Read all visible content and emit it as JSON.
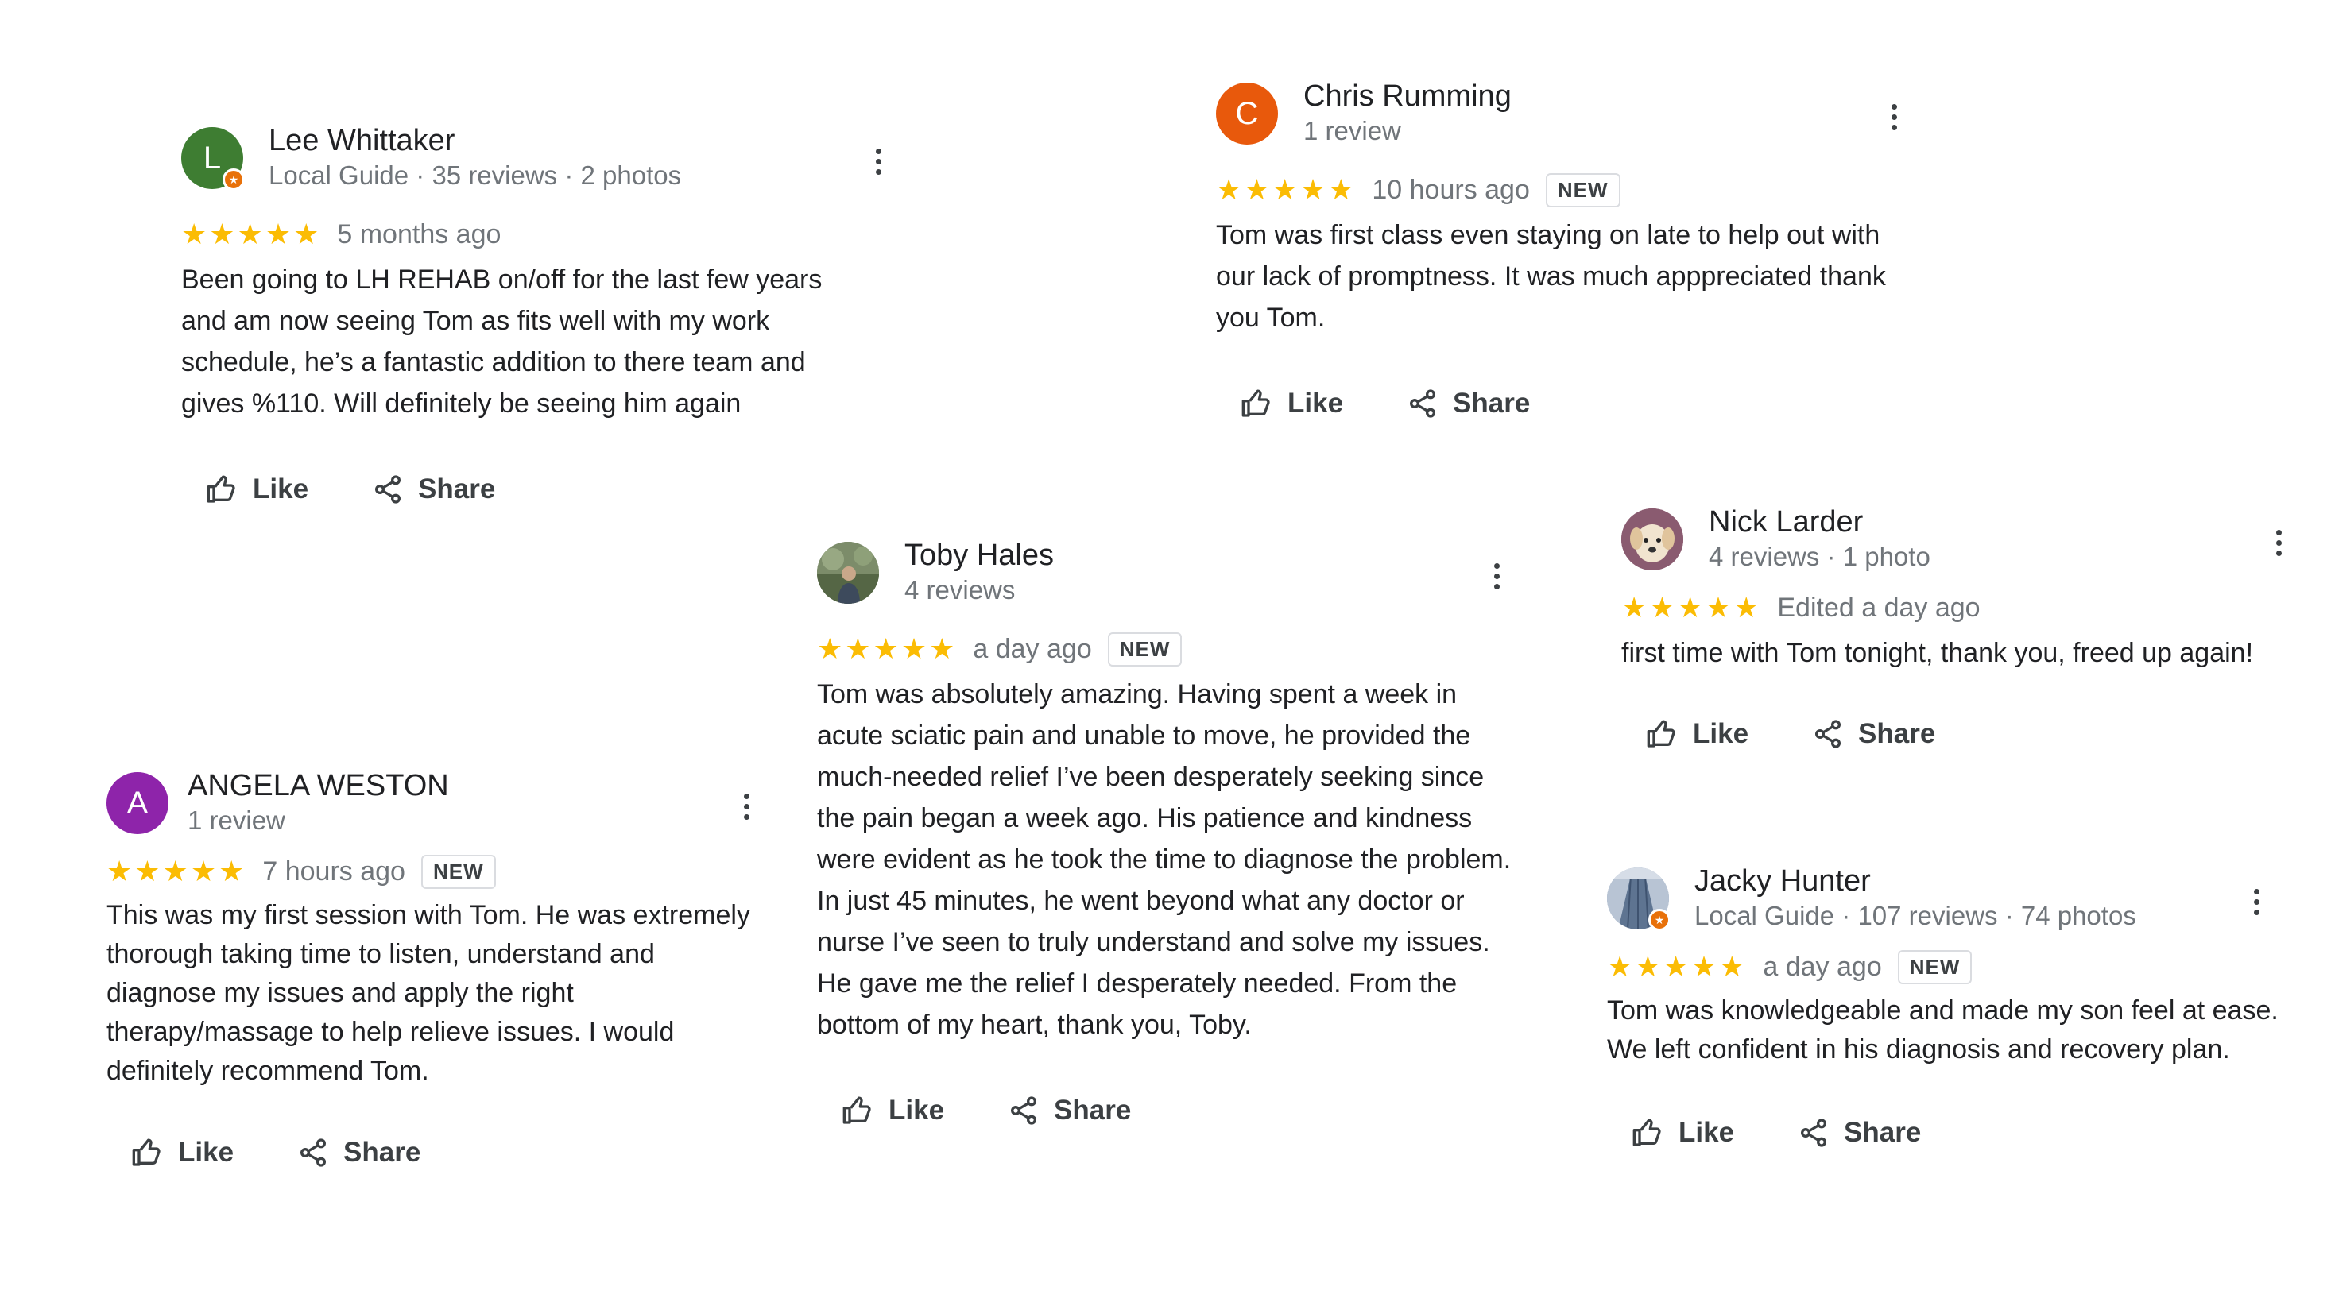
{
  "reviews": [
    {
      "id": "lee",
      "name": "Lee Whittaker",
      "meta": "Local Guide · 35 reviews · 2 photos",
      "avatar_letter": "L",
      "avatar_color": "#3e7d32",
      "local_guide": true,
      "stars": "★★★★★",
      "time": "5 months ago",
      "new_badge": "",
      "text": "Been going to LH REHAB on/off for the last few years and am now seeing Tom as fits well with my work schedule, he’s a fantastic addition to there team and gives %110. Will definitely be seeing him again",
      "like_label": "Like",
      "share_label": "Share"
    },
    {
      "id": "chris",
      "name": "Chris Rumming",
      "meta": "1 review",
      "avatar_letter": "C",
      "avatar_color": "#e8590c",
      "stars": "★★★★★",
      "time": "10 hours ago",
      "new_badge": "NEW",
      "text": "Tom was first class even staying on late to help out with our lack of promptness. It was much apppreciated thank you Tom.",
      "like_label": "Like",
      "share_label": "Share"
    },
    {
      "id": "toby",
      "name": "Toby Hales",
      "meta": "4 reviews",
      "avatar_icon": "outdoor-photo-avatar",
      "stars": "★★★★★",
      "time": "a day ago",
      "new_badge": "NEW",
      "text": "Tom was absolutely amazing.  Having spent a week in acute sciatic pain and unable to move, he provided the much-needed relief I’ve been desperately seeking since the pain began a week ago.  His patience and kindness were evident as he took the time to diagnose the problem.  In just 45 minutes, he went beyond what any doctor or nurse I’ve seen to truly understand and solve my issues.  He gave me the relief I desperately needed. From the bottom of my heart, thank you, Toby.",
      "like_label": "Like",
      "share_label": "Share"
    },
    {
      "id": "nick",
      "name": "Nick Larder",
      "meta": "4 reviews · 1 photo",
      "avatar_icon": "dog-photo-avatar",
      "stars": "★★★★★",
      "time": "Edited a day ago",
      "new_badge": "",
      "text": "first time with Tom tonight, thank you, freed up again!",
      "like_label": "Like",
      "share_label": "Share"
    },
    {
      "id": "angela",
      "name": "ANGELA WESTON",
      "meta": "1 review",
      "avatar_letter": "A",
      "avatar_color": "#8e24aa",
      "stars": "★★★★★",
      "time": "7 hours ago",
      "new_badge": "NEW",
      "text": "This was my first session with Tom. He was extremely thorough taking time to listen, understand and diagnose my issues and apply the right therapy/massage to help relieve issues. I would definitely recommend Tom.",
      "like_label": "Like",
      "share_label": "Share"
    },
    {
      "id": "jacky",
      "name": "Jacky Hunter",
      "meta": "Local Guide · 107 reviews · 74 photos",
      "avatar_icon": "building-photo-avatar",
      "local_guide": true,
      "stars": "★★★★★",
      "time": "a day ago",
      "new_badge": "NEW",
      "text": "Tom was knowledgeable and made my son feel at ease. We left confident in his diagnosis and recovery plan.",
      "like_label": "Like",
      "share_label": "Share"
    }
  ],
  "colors": {
    "star": "#fbbc04",
    "text": "#202124",
    "secondary": "#70757a",
    "local_guide_badge": "#e8710a"
  }
}
